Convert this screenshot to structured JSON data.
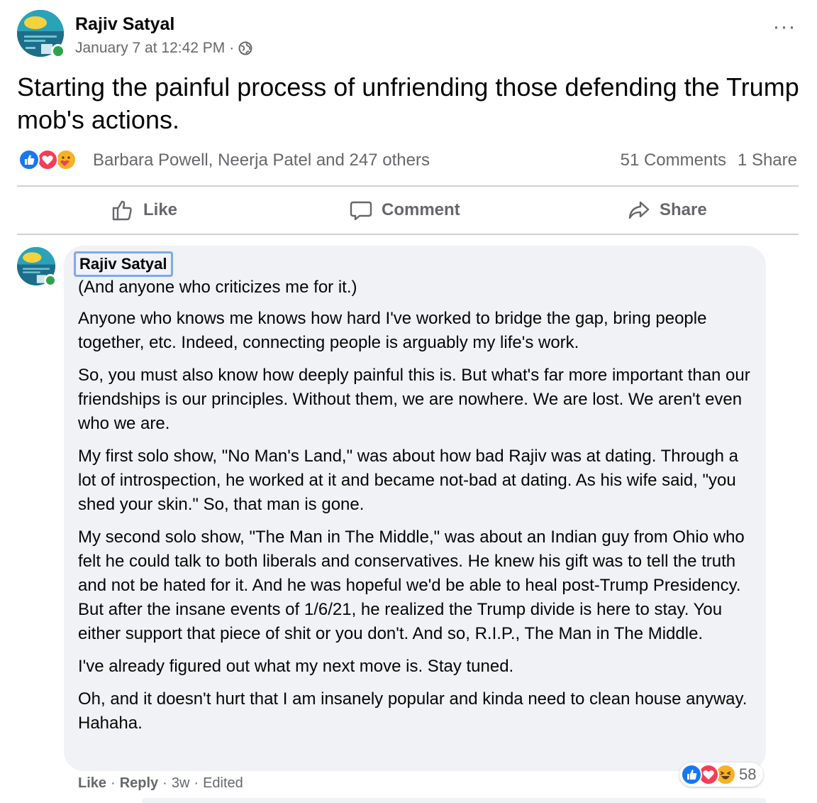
{
  "post": {
    "author": "Rajiv Satyal",
    "date": "January 7 at 12:42 PM",
    "separator": "·",
    "privacy_icon": "globe-icon",
    "more_label": "···",
    "text": "Starting the painful process of unfriending those defending the Trump mob's actions."
  },
  "reactions": {
    "icons": [
      "like-icon",
      "love-icon",
      "care-icon"
    ],
    "names": "Barbara Powell, Neerja Patel and 247 others",
    "comments": "51 Comments",
    "shares": "1 Share"
  },
  "actions": {
    "like": "Like",
    "comment": "Comment",
    "share": "Share"
  },
  "comment": {
    "author": "Rajiv Satyal",
    "paragraphs": [
      "(And anyone who criticizes me for it.)",
      "Anyone who knows me knows how hard I've worked to bridge the gap, bring people together, etc. Indeed, connecting people is arguably my life's work.",
      "So, you must also know how deeply painful this is. But what's far more important than our friendships is our principles. Without them, we are nowhere. We are lost. We aren't even who we are.",
      "My first solo show, \"No Man's Land,\" was about how bad Rajiv was at dating. Through a lot of introspection, he worked at it and became not-bad at dating. As his wife said, \"you shed your skin.\" So, that man is gone.",
      "My second solo show, \"The Man in The Middle,\" was about an Indian guy from Ohio who felt he could talk to both liberals and conservatives. He knew his gift was to tell the truth and not be hated for it. And he was hopeful we'd be able to heal post-Trump Presidency. But after the insane events of 1/6/21, he realized the Trump divide is here to stay. You either support that piece of shit or you don't. And so, R.I.P., The Man in The Middle.",
      "I've already figured out what my next move is. Stay tuned.",
      "Oh, and it doesn't hurt that I am insanely popular and kinda need to clean house anyway. Hahaha."
    ],
    "reaction_icons": [
      "like-icon",
      "love-icon",
      "haha-icon"
    ],
    "reaction_count": "58",
    "footer": {
      "like": "Like",
      "reply": "Reply",
      "time": "3w",
      "edited": "Edited",
      "dot": "·"
    }
  },
  "colors": {
    "like_blue": "#1877f2",
    "love_red": "#f33e58",
    "care_yellow": "#f7b125",
    "online_green": "#31a24c",
    "secondary_text": "#65676b",
    "bubble_bg": "#f0f2f5"
  }
}
